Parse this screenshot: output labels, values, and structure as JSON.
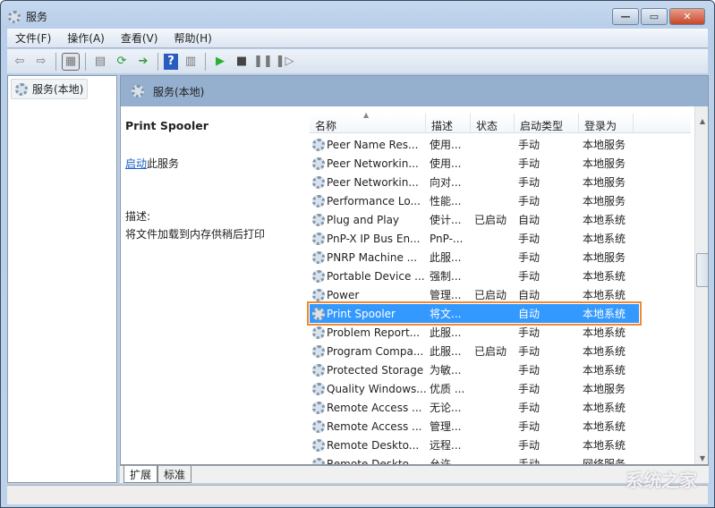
{
  "window": {
    "title": "服务",
    "minimize": "—",
    "maximize": "▭",
    "close": "✕"
  },
  "menu": [
    "文件(F)",
    "操作(A)",
    "查看(V)",
    "帮助(H)"
  ],
  "toolbar_icons": [
    "back-icon",
    "forward-icon",
    "console-tree-icon",
    "properties-icon",
    "refresh-icon",
    "export-icon",
    "help-icon",
    "action-pane-icon",
    "start-icon",
    "stop-icon",
    "pause-icon",
    "resume-icon"
  ],
  "tree": {
    "item": "服务(本地)"
  },
  "band": {
    "title": "服务(本地)"
  },
  "detail": {
    "name": "Print Spooler",
    "start_link": "启动",
    "start_suffix": "此服务",
    "desc_label": "描述:",
    "desc_text": "将文件加载到内存供稍后打印"
  },
  "columns": [
    "名称",
    "描述",
    "状态",
    "启动类型",
    "登录为"
  ],
  "rows": [
    [
      "Peer Name Res...",
      "使用...",
      "",
      "手动",
      "本地服务"
    ],
    [
      "Peer Networkin...",
      "使用...",
      "",
      "手动",
      "本地服务"
    ],
    [
      "Peer Networkin...",
      "向对...",
      "",
      "手动",
      "本地服务"
    ],
    [
      "Performance Lo...",
      "性能...",
      "",
      "手动",
      "本地服务"
    ],
    [
      "Plug and Play",
      "使计...",
      "已启动",
      "自动",
      "本地系统"
    ],
    [
      "PnP-X IP Bus En...",
      "PnP-...",
      "",
      "手动",
      "本地系统"
    ],
    [
      "PNRP Machine ...",
      "此服...",
      "",
      "手动",
      "本地服务"
    ],
    [
      "Portable Device ...",
      "强制...",
      "",
      "手动",
      "本地系统"
    ],
    [
      "Power",
      "管理...",
      "已启动",
      "自动",
      "本地系统"
    ],
    [
      "Print Spooler",
      "将文...",
      "",
      "自动",
      "本地系统"
    ],
    [
      "Problem Report...",
      "此服...",
      "",
      "手动",
      "本地系统"
    ],
    [
      "Program Compa...",
      "此服...",
      "已启动",
      "手动",
      "本地系统"
    ],
    [
      "Protected Storage",
      "为敏...",
      "",
      "手动",
      "本地系统"
    ],
    [
      "Quality Windows...",
      "优质 ...",
      "",
      "手动",
      "本地服务"
    ],
    [
      "Remote Access ...",
      "无论...",
      "",
      "手动",
      "本地系统"
    ],
    [
      "Remote Access ...",
      "管理...",
      "",
      "手动",
      "本地系统"
    ],
    [
      "Remote Deskto...",
      "远程...",
      "",
      "手动",
      "本地系统"
    ],
    [
      "Remote Deskto...",
      "允许...",
      "",
      "手动",
      "网络服务"
    ]
  ],
  "selected_index": 9,
  "colors": {
    "selection": "#3399ff",
    "highlight_border": "#f08a30",
    "band": "#95b0cf"
  },
  "tabs": [
    "扩展",
    "标准"
  ],
  "watermark": "系统之家"
}
